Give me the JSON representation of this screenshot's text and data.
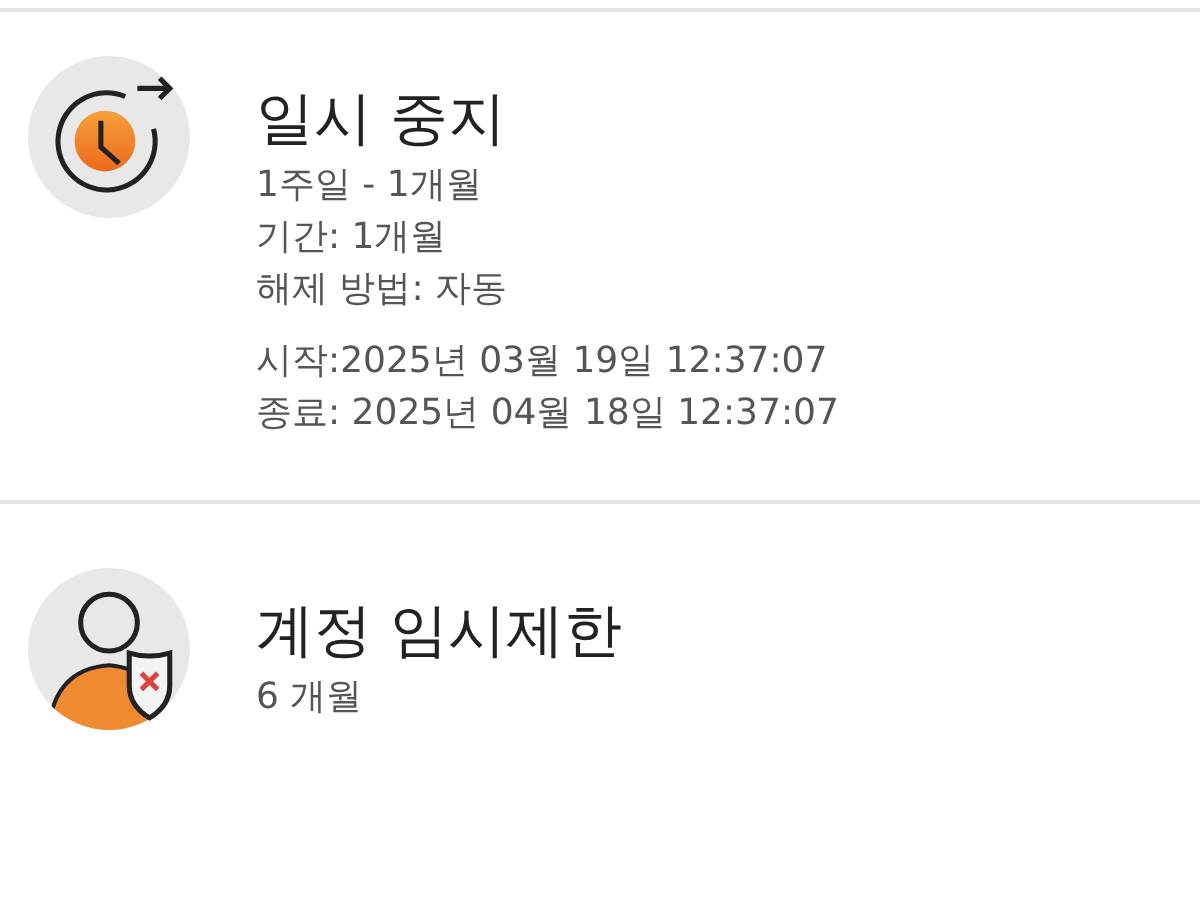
{
  "items": [
    {
      "kind": "clock",
      "title": "일시 중지",
      "groups": [
        [
          "1주일 - 1개월",
          "기간: 1개월",
          "해제 방법: 자동"
        ],
        [
          "시작:2025년 03월 19일 12:37:07",
          "종료: 2025년 04월 18일 12:37:07"
        ]
      ]
    },
    {
      "kind": "user",
      "title": "계정 임시제한",
      "groups": [
        [
          "6 개월"
        ]
      ]
    }
  ]
}
